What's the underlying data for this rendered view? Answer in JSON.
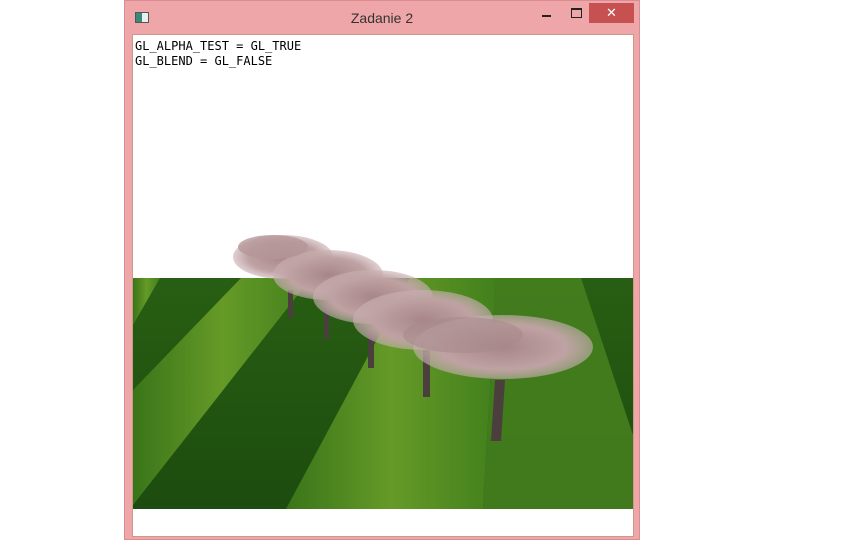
{
  "window": {
    "title": "Zadanie 2",
    "close_glyph": "✕"
  },
  "overlay": {
    "lines": [
      "GL_ALPHA_TEST = GL_TRUE",
      "GL_BLEND = GL_FALSE"
    ]
  },
  "colors": {
    "frame": "#efa6a8",
    "close": "#c75050",
    "grass_light": "#6fa32a",
    "grass_dark": "#1f5a12",
    "blossom": "#b99a9c",
    "trunk": "#4a3f3c"
  }
}
